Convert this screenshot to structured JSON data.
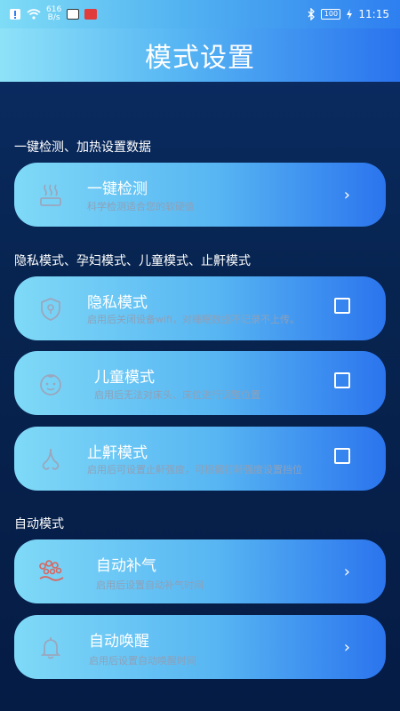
{
  "status_bar": {
    "speed": "616\nB/s",
    "time": "11:15",
    "battery": "100"
  },
  "header": {
    "title": "模式设置"
  },
  "sections": [
    {
      "label": "一键检测、加热设置数据"
    },
    {
      "label": "隐私模式、孕妇模式、儿童模式、止鼾模式"
    },
    {
      "label": "自动模式"
    }
  ],
  "cards": {
    "one_click": {
      "title": "一键检测",
      "desc": "科学检测适合您的软硬值",
      "icon": "heat-icon"
    },
    "privacy": {
      "title": "隐私模式",
      "desc": "启用后关闭设备wifi，对睡眠数据不记录不上传。",
      "icon": "shield-lock-icon",
      "checked": false
    },
    "child": {
      "title": "儿童模式",
      "desc": "启用后无法对床头、床位进行调整位置",
      "icon": "baby-face-icon",
      "checked": false
    },
    "snore": {
      "title": "止鼾模式",
      "desc": "启用后可设置止鼾强度，可根据打鼾强度设置挡位",
      "icon": "nose-icon",
      "checked": false
    },
    "auto_inflate": {
      "title": "自动补气",
      "desc": "启用后设置自动补气时间",
      "icon": "air-bubbles-icon"
    },
    "auto_wake": {
      "title": "自动唤醒",
      "desc": "启用后设置自动唤醒时间",
      "icon": "bell-icon"
    }
  }
}
